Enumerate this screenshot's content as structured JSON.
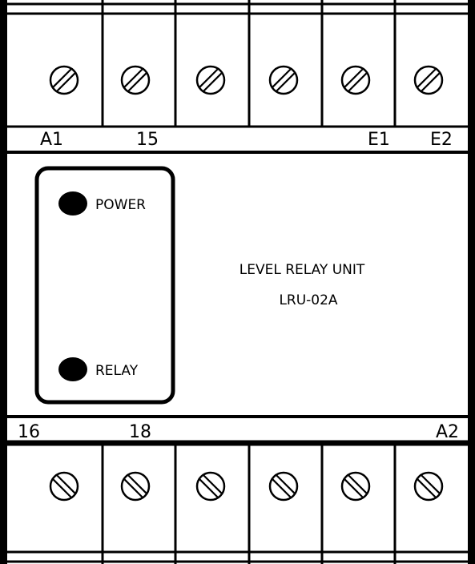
{
  "top_terminals": {
    "labels": [
      "A1",
      "15",
      "",
      "",
      "E1",
      "E2"
    ],
    "screw_icon": "screw-slot-diagonal-right-icon"
  },
  "bottom_terminals": {
    "labels": [
      "16",
      "18",
      "",
      "",
      "",
      "A2"
    ],
    "screw_icon": "screw-slot-diagonal-left-icon"
  },
  "indicators": {
    "power_label": "POWER",
    "relay_label": "RELAY"
  },
  "device": {
    "title": "LEVEL RELAY UNIT",
    "model": "LRU-02A"
  },
  "colors": {
    "frame": "#000000",
    "background": "#ffffff",
    "led": "#000000"
  }
}
